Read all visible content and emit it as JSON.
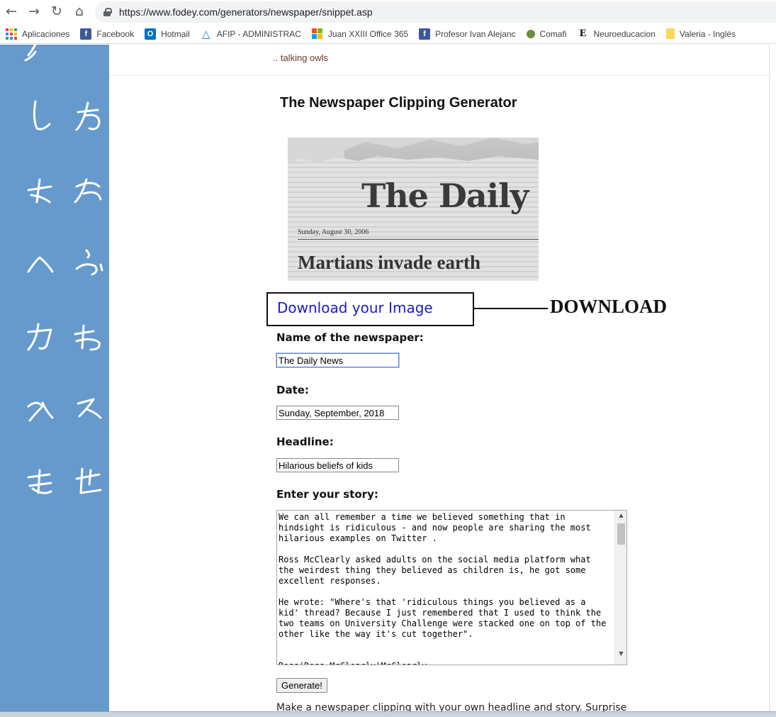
{
  "browser": {
    "url": "https://www.fodey.com/generators/newspaper/snippet.asp",
    "bookmarks": [
      {
        "label": "Aplicaciones",
        "icon": "apps-icon"
      },
      {
        "label": "Facebook",
        "icon": "facebook-icon"
      },
      {
        "label": "Hotmail",
        "icon": "outlook-icon"
      },
      {
        "label": "AFIP - ADMINISTRAC",
        "icon": "afip-icon"
      },
      {
        "label": "Juan XXIII Office 365",
        "icon": "microsoft-icon"
      },
      {
        "label": "Profesor Ivan Alejanc",
        "icon": "facebook-icon"
      },
      {
        "label": "Comafi",
        "icon": "comafi-icon"
      },
      {
        "label": "Neuroeducacion",
        "icon": "e-icon"
      },
      {
        "label": "Valeria - Inglés",
        "icon": "folder-icon"
      }
    ]
  },
  "page": {
    "top_link": ".. talking owls",
    "title": "The Newspaper Clipping Generator",
    "clipping": {
      "masthead": "The Daily N",
      "date": "Sunday, August 30, 2006",
      "headline": "Martians invade earth"
    },
    "download_link": "Download your Image",
    "download_annotation": "DOWNLOAD",
    "form": {
      "name_label": "Name of the newspaper:",
      "name_value": "The Daily News",
      "date_label": "Date:",
      "date_value": "Sunday, September, 2018",
      "headline_label": "Headline:",
      "headline_value": "Hilarious beliefs of kids",
      "story_label": "Enter your story:",
      "story_value": "We can all remember a time we believed something that in\nhindsight is ridiculous - and now people are sharing the most\nhilarious examples on Twitter .\n\nRoss McClearly asked adults on the social media platform what\nthe weirdest thing they believed as children is, he got some\nexcellent responses.\n\nHe wrote: \"Where's that 'ridiculous things you believed as a\nkid' thread? Because I just remembered that I used to think the\ntwo teams on University Challenge were stacked one on top of the\nother like the way it's cut together\".\n\n\nRoss(Ross_McClearly)McClearly",
      "generate_label": "Generate!"
    },
    "footer": "Make a newspaper clipping with your own headline and story. Surprise"
  },
  "colors": {
    "sidebar": "#6699cc",
    "link": "#1a1acc",
    "top_link": "#6b3b2a"
  }
}
